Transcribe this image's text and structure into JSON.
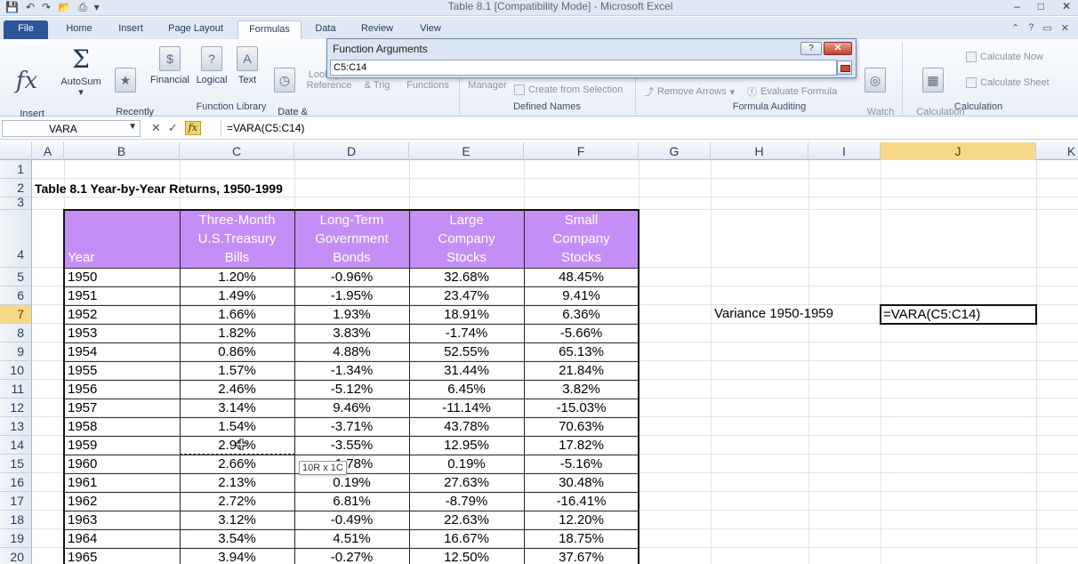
{
  "window": {
    "title": "Table 8.1  [Compatibility Mode]  -  Microsoft Excel",
    "controls": {
      "minimize": "–",
      "maximize": "□",
      "close": "✕"
    }
  },
  "tabs": [
    {
      "label": "File"
    },
    {
      "label": "Home"
    },
    {
      "label": "Insert"
    },
    {
      "label": "Page Layout"
    },
    {
      "label": "Formulas"
    },
    {
      "label": "Data"
    },
    {
      "label": "Review"
    },
    {
      "label": "View"
    }
  ],
  "ribbon": {
    "insert_function": "Insert\nFunction",
    "autosum": "AutoSum",
    "recently_used": "Recently\nUsed",
    "financial": "Financial",
    "logical": "Logical",
    "text": "Text",
    "date_time": "Date &\nTime",
    "lookup_reference": "Lookup &\nReference",
    "math_trig": "Math\n& Trig",
    "more_functions": "More\nFunctions",
    "name_manager": "Name\nManager",
    "create_from_selection": "Create from Selection",
    "remove_arrows": "Remove Arrows",
    "evaluate_formula": "Evaluate Formula",
    "watch_window": "Watch\nWindow",
    "calculation_options": "Calculation\nOptions",
    "calculate_now": "Calculate Now",
    "calculate_sheet": "Calculate Sheet",
    "groups": {
      "function_library": "Function Library",
      "defined_names": "Defined Names",
      "formula_auditing": "Formula Auditing",
      "calculation": "Calculation"
    }
  },
  "function_arguments": {
    "title": "Function Arguments",
    "help": "?",
    "input": "C5:C14"
  },
  "formula_bar": {
    "name_box": "VARA",
    "formula": "=VARA(C5:C14)"
  },
  "columns": [
    "A",
    "B",
    "C",
    "D",
    "E",
    "F",
    "G",
    "H",
    "I",
    "J",
    "K"
  ],
  "rows": [
    "1",
    "2",
    "3",
    "4",
    "5",
    "6",
    "7",
    "8",
    "9",
    "10",
    "11",
    "12",
    "13",
    "14",
    "15",
    "16",
    "17",
    "18",
    "19",
    "20"
  ],
  "sheet": {
    "table_title": "Table 8.1  Year-by-Year Returns, 1950-1999",
    "headers": {
      "year": "Year",
      "tbills": [
        "Three-Month",
        "U.S.Treasury",
        "Bills"
      ],
      "bonds": [
        "Long-Term",
        "Government",
        "Bonds"
      ],
      "large": [
        "Large",
        "Company",
        "Stocks"
      ],
      "small": [
        "Small",
        "Company",
        "Stocks"
      ]
    },
    "data": [
      [
        "1950",
        "1.20%",
        "-0.96%",
        "32.68%",
        "48.45%"
      ],
      [
        "1951",
        "1.49%",
        "-1.95%",
        "23.47%",
        "9.41%"
      ],
      [
        "1952",
        "1.66%",
        "1.93%",
        "18.91%",
        "6.36%"
      ],
      [
        "1953",
        "1.82%",
        "3.83%",
        "-1.74%",
        "-5.66%"
      ],
      [
        "1954",
        "0.86%",
        "4.88%",
        "52.55%",
        "65.13%"
      ],
      [
        "1955",
        "1.57%",
        "-1.34%",
        "31.44%",
        "21.84%"
      ],
      [
        "1956",
        "2.46%",
        "-5.12%",
        "6.45%",
        "3.82%"
      ],
      [
        "1957",
        "3.14%",
        "9.46%",
        "-11.14%",
        "-15.03%"
      ],
      [
        "1958",
        "1.54%",
        "-3.71%",
        "43.78%",
        "70.63%"
      ],
      [
        "1959",
        "2.95%",
        "-3.55%",
        "12.95%",
        "17.82%"
      ],
      [
        "1960",
        "2.66%",
        "-1.78%",
        "0.19%",
        "-5.16%"
      ],
      [
        "1961",
        "2.13%",
        "0.19%",
        "27.63%",
        "30.48%"
      ],
      [
        "1962",
        "2.72%",
        "6.81%",
        "-8.79%",
        "-16.41%"
      ],
      [
        "1963",
        "3.12%",
        "-0.49%",
        "22.63%",
        "12.20%"
      ],
      [
        "1964",
        "3.54%",
        "4.51%",
        "16.67%",
        "18.75%"
      ],
      [
        "1965",
        "3.94%",
        "-0.27%",
        "12.50%",
        "37.67%"
      ]
    ],
    "variance_label": "Variance 1950-1959",
    "variance_formula": "=VARA(C5:C14)",
    "tooltip": "10R x 1C"
  },
  "colors": {
    "header_fill": "#c58ef6",
    "selection_header": "#f8d98a",
    "file_tab": "#2b579a"
  }
}
